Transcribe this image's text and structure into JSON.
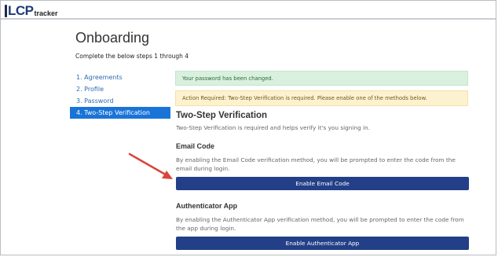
{
  "app": {
    "logo_text": "LCP",
    "logo_suffix": "tracker"
  },
  "page": {
    "title": "Onboarding",
    "subtitle": "Complete the below steps 1 through 4"
  },
  "steps": [
    {
      "label": "1. Agreements",
      "active": false
    },
    {
      "label": "2. Profile",
      "active": false
    },
    {
      "label": "3. Password",
      "active": false
    },
    {
      "label": "4. Two-Step Verification",
      "active": true
    }
  ],
  "alerts": {
    "success": "Your password has been changed.",
    "warning": "Action Required: Two-Step Verification is required. Please enable one of the methods below."
  },
  "verification": {
    "heading": "Two-Step Verification",
    "description": "Two-Step Verification is required and helps verify it's you signing in.",
    "email": {
      "heading": "Email Code",
      "description": "By enabling the Email Code verification method, you will be prompted to enter the code from the email during login.",
      "button_label": "Enable Email Code"
    },
    "authenticator": {
      "heading": "Authenticator App",
      "description": "By enabling the Authenticator App verification method, you will be prompted to enter the code from the app during login.",
      "button_label": "Enable Authenticator App"
    }
  },
  "colors": {
    "primary_button": "#233f87",
    "active_step": "#1a74d8",
    "step_link": "#2e6cb2",
    "success_bg": "#d9f0df",
    "warning_bg": "#fdf2cf",
    "annotation_arrow": "#d9453b"
  },
  "annotation": {
    "icon": "red-arrow-icon"
  }
}
